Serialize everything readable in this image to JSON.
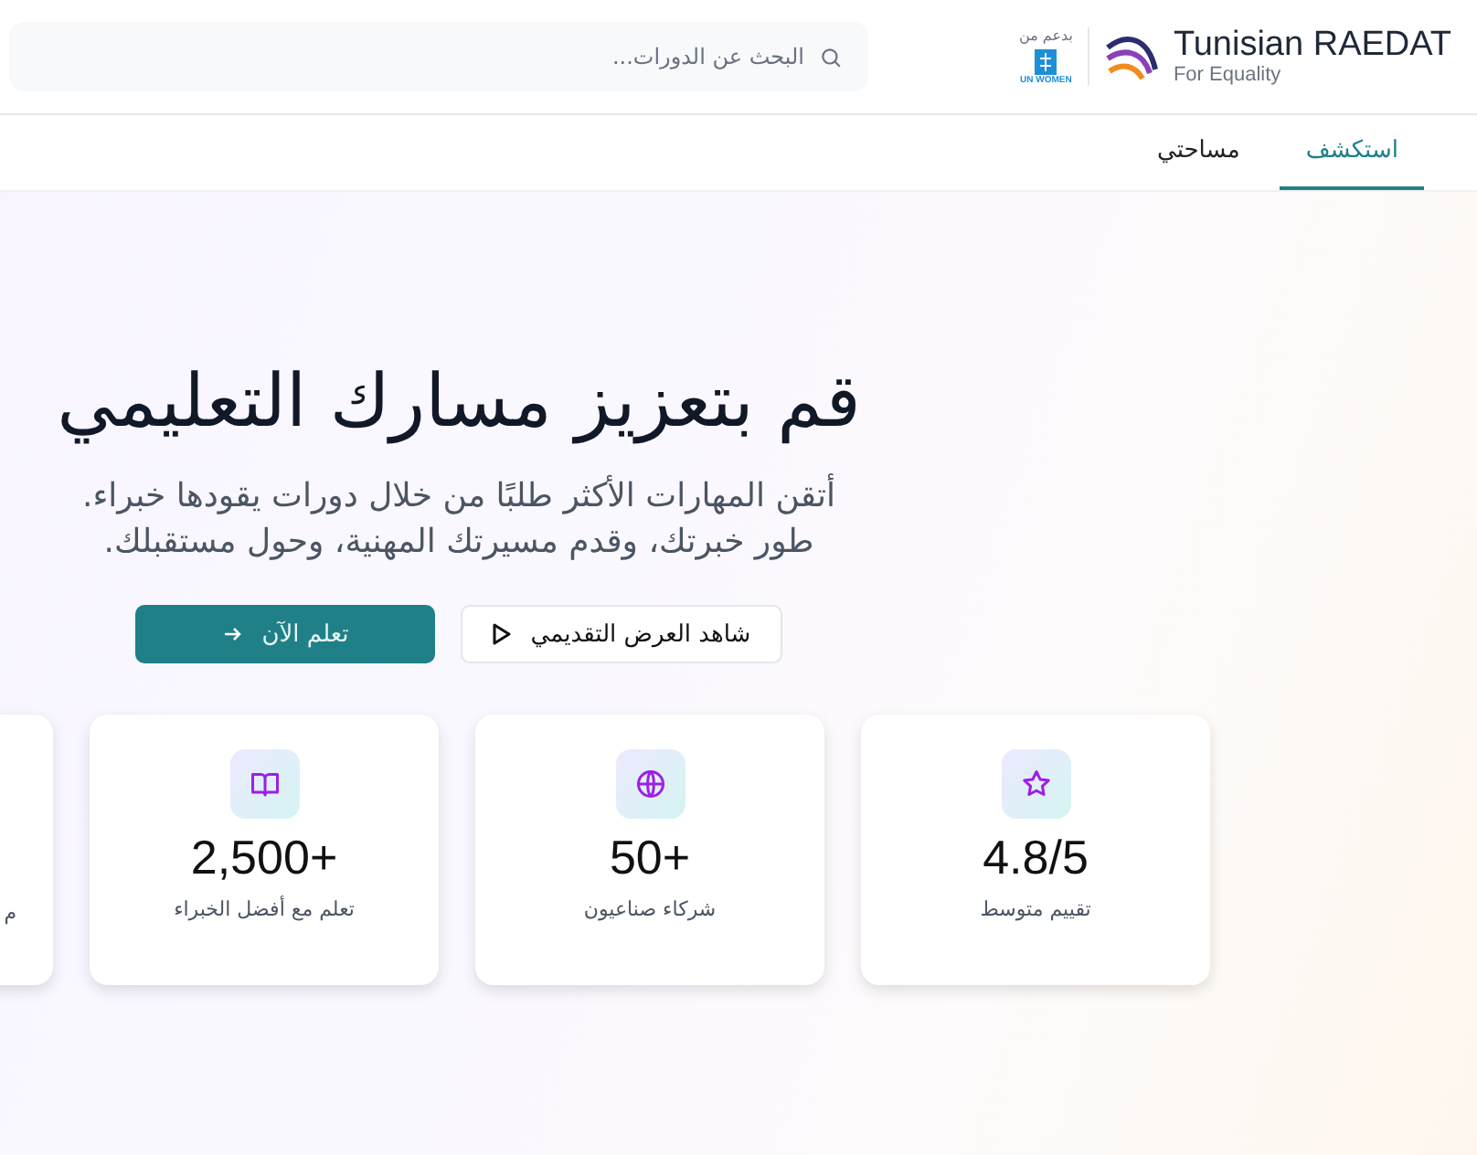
{
  "brand": {
    "name": "Tunisian RAEDAT",
    "tagline": "For Equality",
    "supported_by": "بدعم من",
    "partner": "UN WOMEN"
  },
  "search": {
    "placeholder": "البحث عن الدورات..."
  },
  "tabs": [
    {
      "label": "استكشف",
      "selected": true
    },
    {
      "label": "مساحتي",
      "selected": false
    }
  ],
  "hero": {
    "title": "قم بتعزيز مسارك التعليمي",
    "subtitle": "أتقن المهارات الأكثر طلبًا من خلال دورات يقودها خبراء. طور خبرتك، وقدم مسيرتك المهنية، وحول مستقبلك.",
    "buttons": [
      {
        "label": "شاهد العرض التقديمي",
        "kind": "secondary"
      },
      {
        "label": "تعلم الآن",
        "kind": "primary"
      }
    ]
  },
  "stats": [
    {
      "kind": "star",
      "value": "4.8/5",
      "label": "تقييم متوسط"
    },
    {
      "kind": "globe",
      "value": "50+",
      "label": "شركاء صناعيون"
    },
    {
      "kind": "book",
      "value": "2,500+",
      "label": "تعلم مع أفضل الخبراء"
    },
    {
      "kind": "partial",
      "label": "م"
    }
  ]
}
